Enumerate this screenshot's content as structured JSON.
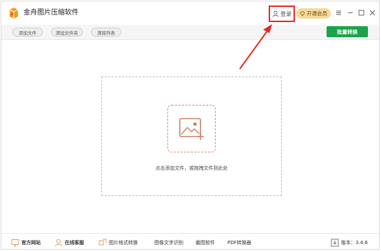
{
  "app": {
    "title": "金舟图片压缩软件"
  },
  "header": {
    "login_label": "登录",
    "vip_label": "开通会员"
  },
  "toolbar": {
    "add_file_label": "添加文件",
    "add_folder_label": "添加文件夹",
    "clear_list_label": "清除列表",
    "batch_convert_label": "批量转换"
  },
  "dropzone": {
    "hint": "点击添加文件，或拖拽文件到此处"
  },
  "footer": {
    "official_site": "官方网站",
    "online_service": "在线客服",
    "format_convert": "图片格式转换",
    "ocr": "图像文字识别",
    "screenshot": "截图软件",
    "pdf_convert": "PDF转换器",
    "version": "版本：3.4.6"
  },
  "colors": {
    "accent_green": "#1aa34a",
    "highlight_red": "#e8261f",
    "vip_gold": "#f6d99b",
    "drop_orange": "#d58a6a"
  },
  "icons": {
    "logo": "app-logo-icon",
    "login": "user-icon",
    "vip": "diamond-icon",
    "menu": "menu-icon",
    "minimize": "minimize-icon",
    "maximize": "maximize-icon",
    "close": "close-icon",
    "drop": "image-add-icon"
  }
}
